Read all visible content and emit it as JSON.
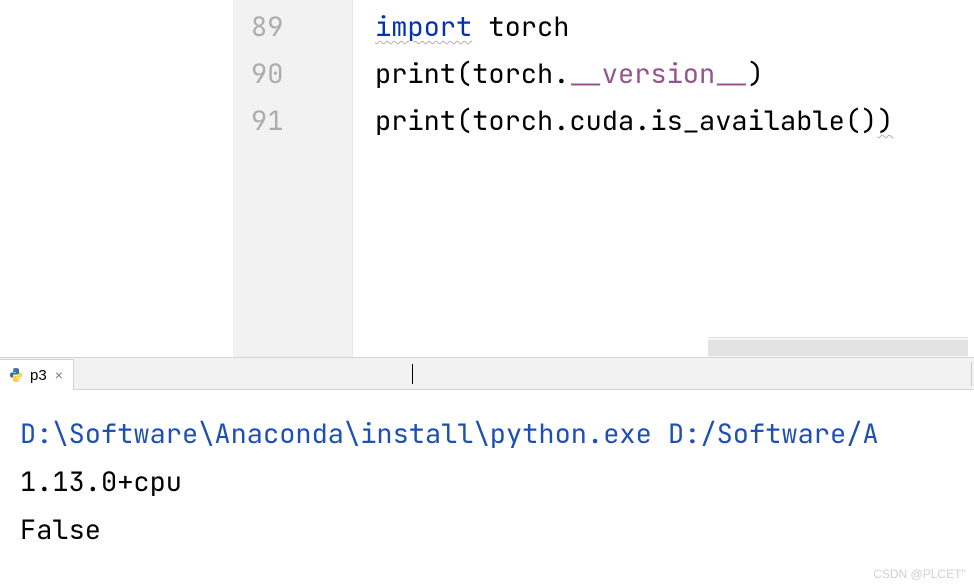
{
  "editor": {
    "lines": [
      {
        "num": "89",
        "tokens": [
          {
            "text": "import",
            "class": "kw wavy"
          },
          {
            "text": " ",
            "class": ""
          },
          {
            "text": "torch",
            "class": "id"
          }
        ]
      },
      {
        "num": "90",
        "tokens": [
          {
            "text": "print",
            "class": "fn"
          },
          {
            "text": "(",
            "class": "paren"
          },
          {
            "text": "torch",
            "class": "id"
          },
          {
            "text": ".",
            "class": "dot"
          },
          {
            "text": "__version__",
            "class": "attr"
          },
          {
            "text": ")",
            "class": "paren"
          }
        ]
      },
      {
        "num": "91",
        "tokens": [
          {
            "text": "print",
            "class": "fn"
          },
          {
            "text": "(",
            "class": "paren"
          },
          {
            "text": "torch",
            "class": "id"
          },
          {
            "text": ".",
            "class": "dot"
          },
          {
            "text": "cuda",
            "class": "id"
          },
          {
            "text": ".",
            "class": "dot"
          },
          {
            "text": "is_available",
            "class": "id"
          },
          {
            "text": "()",
            "class": "paren"
          },
          {
            "text": ")",
            "class": "paren wavy"
          }
        ]
      }
    ]
  },
  "tab": {
    "label": "p3",
    "close_glyph": "×"
  },
  "console": {
    "command": "D:\\Software\\Anaconda\\install\\python.exe D:/Software/A",
    "output1": "1.13.0+cpu",
    "output2": "False"
  },
  "watermark": "CSDN @PLCET''"
}
